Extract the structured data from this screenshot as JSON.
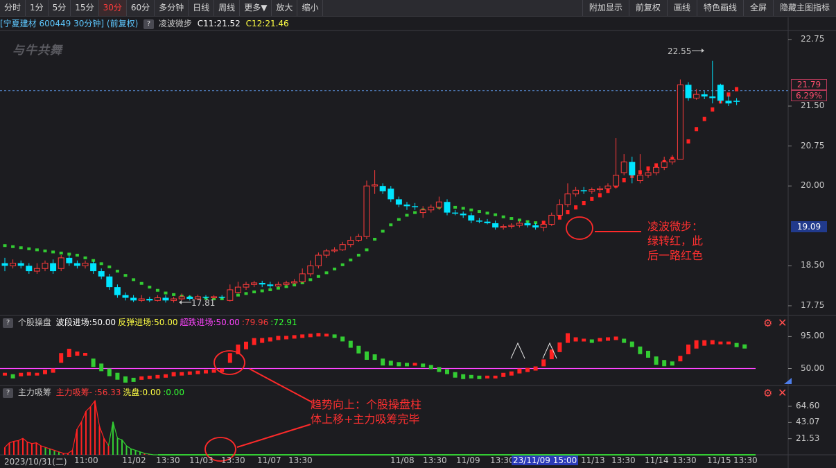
{
  "toolbar": {
    "left": [
      "分时",
      "1分",
      "5分",
      "15分",
      "30分",
      "60分",
      "多分钟",
      "日线",
      "周线",
      "更多▼",
      "放大",
      "缩小"
    ],
    "active": "30分",
    "right": [
      "附加显示",
      "前复权",
      "画线",
      "特色画线",
      "全屏",
      "隐藏主图指标"
    ]
  },
  "title": {
    "stock": "[宁夏建材 600449 30分钟] (前复权)",
    "indicator": "凌波微步",
    "c11": "C11:21.52",
    "c12": "C12:21.46"
  },
  "logo": "与牛共舞",
  "main_axis": {
    "ticks": [
      "22.75",
      "21.50",
      "20.75",
      "20.00",
      "18.50",
      "17.75"
    ],
    "current_price": "21.79",
    "current_pct": "6.29%",
    "cursor_price": "19.09"
  },
  "main_marks": {
    "high": "22.55",
    "low": "17.81"
  },
  "panel2": {
    "title": "个股操盘",
    "items": [
      {
        "text": "波段进场:50.00",
        "color": "#ffffff"
      },
      {
        "text": "反弹进场:50.00",
        "color": "#ffff44"
      },
      {
        "text": "超跌进场:50.00",
        "color": "#ff44ff"
      },
      {
        "text": ":79.96",
        "color": "#ff3b3b"
      },
      {
        "text": ":72.91",
        "color": "#33ff33"
      }
    ],
    "ticks": [
      "95.00",
      "50.00"
    ]
  },
  "panel3": {
    "title": "主力吸筹",
    "items": [
      {
        "text": "主力吸筹-",
        "color": "#ff3b3b"
      },
      {
        "text": ":56.33",
        "color": "#ff3b3b"
      },
      {
        "text": "洗盘:0.00",
        "color": "#ffff44"
      },
      {
        "text": ":0.00",
        "color": "#33ff33"
      }
    ],
    "ticks": [
      "64.60",
      "43.07",
      "21.53"
    ]
  },
  "xaxis": {
    "labels": [
      "2023/10/31(二)",
      "11:00",
      "11/02",
      "13:30",
      "11/03",
      "13:30",
      "11/07",
      "13:30",
      "11/08",
      "13:30",
      "11/09",
      "13:30",
      "23/11/09 15:00",
      "11/13",
      "13:30",
      "11/14",
      "13:30",
      "11/15",
      "13:30"
    ],
    "highlight": "23/11/09 15:00"
  },
  "annotations": {
    "a1": [
      "凌波微步：",
      "绿转红，此",
      "后一路红色"
    ],
    "a2": [
      "趋势向上：个股操盘柱",
      "体上移+主力吸筹完毕"
    ]
  },
  "colors": {
    "up": "#ff3b3b",
    "down": "#00e5ff",
    "green": "#33cc33",
    "red": "#ff2222",
    "magenta": "#ff44ff",
    "blue_dash": "#5a8fd8"
  },
  "chart_data": {
    "type": "candlestick",
    "ylim": [
      17.6,
      22.95
    ],
    "candles": [
      [
        18.55,
        18.5,
        18.65,
        18.4
      ],
      [
        18.5,
        18.55,
        18.62,
        18.45
      ],
      [
        18.55,
        18.5,
        18.6,
        18.45
      ],
      [
        18.5,
        18.4,
        18.55,
        18.35
      ],
      [
        18.4,
        18.45,
        18.55,
        18.35
      ],
      [
        18.45,
        18.55,
        18.6,
        18.4
      ],
      [
        18.55,
        18.4,
        18.62,
        18.35
      ],
      [
        18.45,
        18.65,
        18.7,
        18.4
      ],
      [
        18.65,
        18.55,
        18.7,
        18.5
      ],
      [
        18.55,
        18.5,
        18.6,
        18.45
      ],
      [
        18.5,
        18.55,
        18.6,
        18.45
      ],
      [
        18.55,
        18.4,
        18.6,
        18.35
      ],
      [
        18.4,
        18.3,
        18.45,
        18.25
      ],
      [
        18.3,
        18.1,
        18.35,
        18.05
      ],
      [
        18.1,
        17.95,
        18.15,
        17.9
      ],
      [
        17.95,
        17.9,
        18.0,
        17.85
      ],
      [
        17.9,
        17.85,
        17.95,
        17.82
      ],
      [
        17.85,
        17.88,
        17.95,
        17.82
      ],
      [
        17.88,
        17.85,
        17.92,
        17.82
      ],
      [
        17.85,
        17.9,
        17.95,
        17.83
      ],
      [
        17.9,
        17.85,
        17.95,
        17.81
      ],
      [
        17.85,
        17.88,
        17.92,
        17.81
      ],
      [
        17.88,
        17.92,
        17.98,
        17.85
      ],
      [
        17.92,
        17.88,
        17.95,
        17.85
      ],
      [
        17.88,
        17.92,
        17.96,
        17.86
      ],
      [
        17.92,
        17.9,
        17.95,
        17.88
      ],
      [
        17.9,
        17.92,
        17.95,
        17.88
      ],
      [
        17.92,
        17.9,
        17.95,
        17.88
      ],
      [
        17.85,
        18.05,
        18.15,
        17.83
      ],
      [
        18.0,
        18.1,
        18.2,
        17.98
      ],
      [
        18.1,
        18.15,
        18.2,
        18.05
      ],
      [
        18.15,
        18.18,
        18.22,
        18.1
      ],
      [
        18.18,
        18.15,
        18.22,
        18.1
      ],
      [
        18.15,
        18.12,
        18.2,
        18.08
      ],
      [
        18.12,
        18.15,
        18.2,
        18.1
      ],
      [
        18.15,
        18.18,
        18.22,
        18.12
      ],
      [
        18.18,
        18.2,
        18.25,
        18.15
      ],
      [
        18.2,
        18.35,
        18.45,
        18.18
      ],
      [
        18.35,
        18.5,
        18.6,
        18.3
      ],
      [
        18.5,
        18.7,
        18.75,
        18.45
      ],
      [
        18.7,
        18.78,
        18.82,
        18.65
      ],
      [
        18.78,
        18.8,
        18.85,
        18.75
      ],
      [
        18.8,
        18.9,
        18.95,
        18.78
      ],
      [
        18.9,
        18.98,
        19.05,
        18.85
      ],
      [
        18.98,
        19.05,
        19.1,
        18.95
      ],
      [
        19.05,
        20.0,
        20.1,
        19.0
      ],
      [
        20.0,
        20.02,
        20.3,
        19.85
      ],
      [
        20.0,
        19.9,
        20.05,
        19.85
      ],
      [
        19.95,
        19.75,
        20.0,
        19.7
      ],
      [
        19.75,
        19.65,
        19.8,
        19.6
      ],
      [
        19.65,
        19.62,
        19.7,
        19.55
      ],
      [
        19.62,
        19.6,
        19.68,
        19.55
      ],
      [
        19.5,
        19.55,
        19.62,
        19.4
      ],
      [
        19.55,
        19.6,
        19.65,
        19.5
      ],
      [
        19.6,
        19.7,
        19.8,
        19.55
      ],
      [
        19.7,
        19.5,
        19.75,
        19.45
      ],
      [
        19.5,
        19.48,
        19.55,
        19.45
      ],
      [
        19.48,
        19.45,
        19.52,
        19.4
      ],
      [
        19.45,
        19.35,
        19.5,
        19.3
      ],
      [
        19.35,
        19.33,
        19.4,
        19.3
      ],
      [
        19.33,
        19.3,
        19.38,
        19.28
      ],
      [
        19.3,
        19.22,
        19.35,
        19.18
      ],
      [
        19.22,
        19.24,
        19.28,
        19.18
      ],
      [
        19.24,
        19.26,
        19.3,
        19.2
      ],
      [
        19.26,
        19.3,
        19.35,
        19.22
      ],
      [
        19.3,
        19.26,
        19.33,
        19.22
      ],
      [
        19.26,
        19.22,
        19.3,
        19.18
      ],
      [
        19.22,
        19.28,
        19.32,
        19.15
      ],
      [
        19.28,
        19.45,
        19.5,
        19.25
      ],
      [
        19.45,
        19.65,
        19.75,
        19.4
      ],
      [
        19.65,
        19.85,
        20.05,
        19.6
      ],
      [
        19.85,
        19.92,
        19.98,
        19.8
      ],
      [
        19.92,
        19.9,
        19.98,
        19.85
      ],
      [
        19.9,
        19.93,
        19.97,
        19.85
      ],
      [
        19.93,
        19.95,
        20.0,
        19.88
      ],
      [
        19.95,
        20.0,
        20.05,
        19.92
      ],
      [
        20.0,
        20.2,
        20.9,
        19.95
      ],
      [
        20.25,
        20.45,
        20.6,
        20.2
      ],
      [
        20.45,
        20.2,
        20.55,
        20.05
      ],
      [
        20.1,
        20.2,
        20.6,
        20.05
      ],
      [
        20.2,
        20.25,
        20.32,
        20.15
      ],
      [
        20.25,
        20.35,
        20.42,
        20.2
      ],
      [
        20.35,
        20.45,
        20.55,
        20.3
      ],
      [
        20.45,
        20.5,
        20.58,
        20.4
      ],
      [
        20.5,
        21.9,
        22.0,
        20.6
      ],
      [
        21.9,
        21.65,
        21.95,
        21.6
      ],
      [
        21.65,
        21.72,
        21.82,
        21.62
      ],
      [
        21.72,
        21.68,
        21.78,
        21.63
      ],
      [
        21.68,
        21.65,
        22.35,
        21.55
      ],
      [
        21.9,
        21.6,
        21.92,
        21.55
      ],
      [
        21.6,
        21.55,
        21.7,
        21.5
      ],
      [
        21.6,
        21.58,
        21.65,
        21.52
      ]
    ],
    "lingbo": [
      18.88,
      18.86,
      18.84,
      18.82,
      18.8,
      18.78,
      18.76,
      18.74,
      18.72,
      18.7,
      18.65,
      18.6,
      18.54,
      18.48,
      18.4,
      18.32,
      18.24,
      18.17,
      18.1,
      18.04,
      17.99,
      17.96,
      17.93,
      17.91,
      17.9,
      17.89,
      17.88,
      17.88,
      17.92,
      17.95,
      17.98,
      18.01,
      18.03,
      18.05,
      18.08,
      18.11,
      18.14,
      18.18,
      18.24,
      18.3,
      18.37,
      18.44,
      18.52,
      18.61,
      18.7,
      18.8,
      19.0,
      19.15,
      19.27,
      19.37,
      19.45,
      19.5,
      19.55,
      19.58,
      19.6,
      19.61,
      19.6,
      19.58,
      19.55,
      19.52,
      19.49,
      19.46,
      19.42,
      19.39,
      19.36,
      19.33,
      19.31,
      19.32,
      19.36,
      19.42,
      19.52,
      19.61,
      19.69,
      19.77,
      19.84,
      19.92,
      20.02,
      20.12,
      20.2,
      20.27,
      20.34,
      20.4,
      20.46,
      20.52,
      20.57,
      20.85,
      21.08,
      21.27,
      21.45,
      21.6,
      21.73,
      21.83
    ],
    "lingbo_turn_red_index": 67,
    "oscillator": [
      42,
      40,
      41,
      42,
      42,
      44,
      46,
      60,
      68,
      70,
      70,
      62,
      55,
      48,
      42,
      37,
      35,
      36,
      37,
      38,
      39,
      41,
      42,
      43,
      44,
      45,
      46,
      47,
      60,
      72,
      79,
      85,
      88,
      90,
      92,
      93,
      94,
      95,
      96,
      97,
      97,
      96,
      93,
      87,
      80,
      72,
      68,
      62,
      59,
      57,
      56,
      56,
      55,
      53,
      50,
      47,
      43,
      40,
      39,
      38,
      38,
      38,
      40,
      42,
      45,
      47,
      49,
      55,
      65,
      75,
      88,
      90,
      90,
      89,
      90,
      91,
      92,
      90,
      86,
      79,
      73,
      65,
      60,
      58,
      62,
      72,
      80,
      84,
      86,
      86,
      86,
      84,
      82
    ],
    "oscillator_ylim": [
      30,
      110
    ],
    "oscillator_line": 50,
    "xichou": [
      10,
      16,
      18,
      19,
      22,
      17,
      15,
      16,
      12,
      10,
      8,
      6,
      4,
      2,
      2,
      6,
      34,
      44,
      58,
      64,
      72,
      38,
      22,
      12,
      44,
      22,
      20,
      12,
      8,
      6,
      4,
      2,
      1,
      0,
      0
    ],
    "xichou_ylim": [
      0,
      72
    ]
  }
}
